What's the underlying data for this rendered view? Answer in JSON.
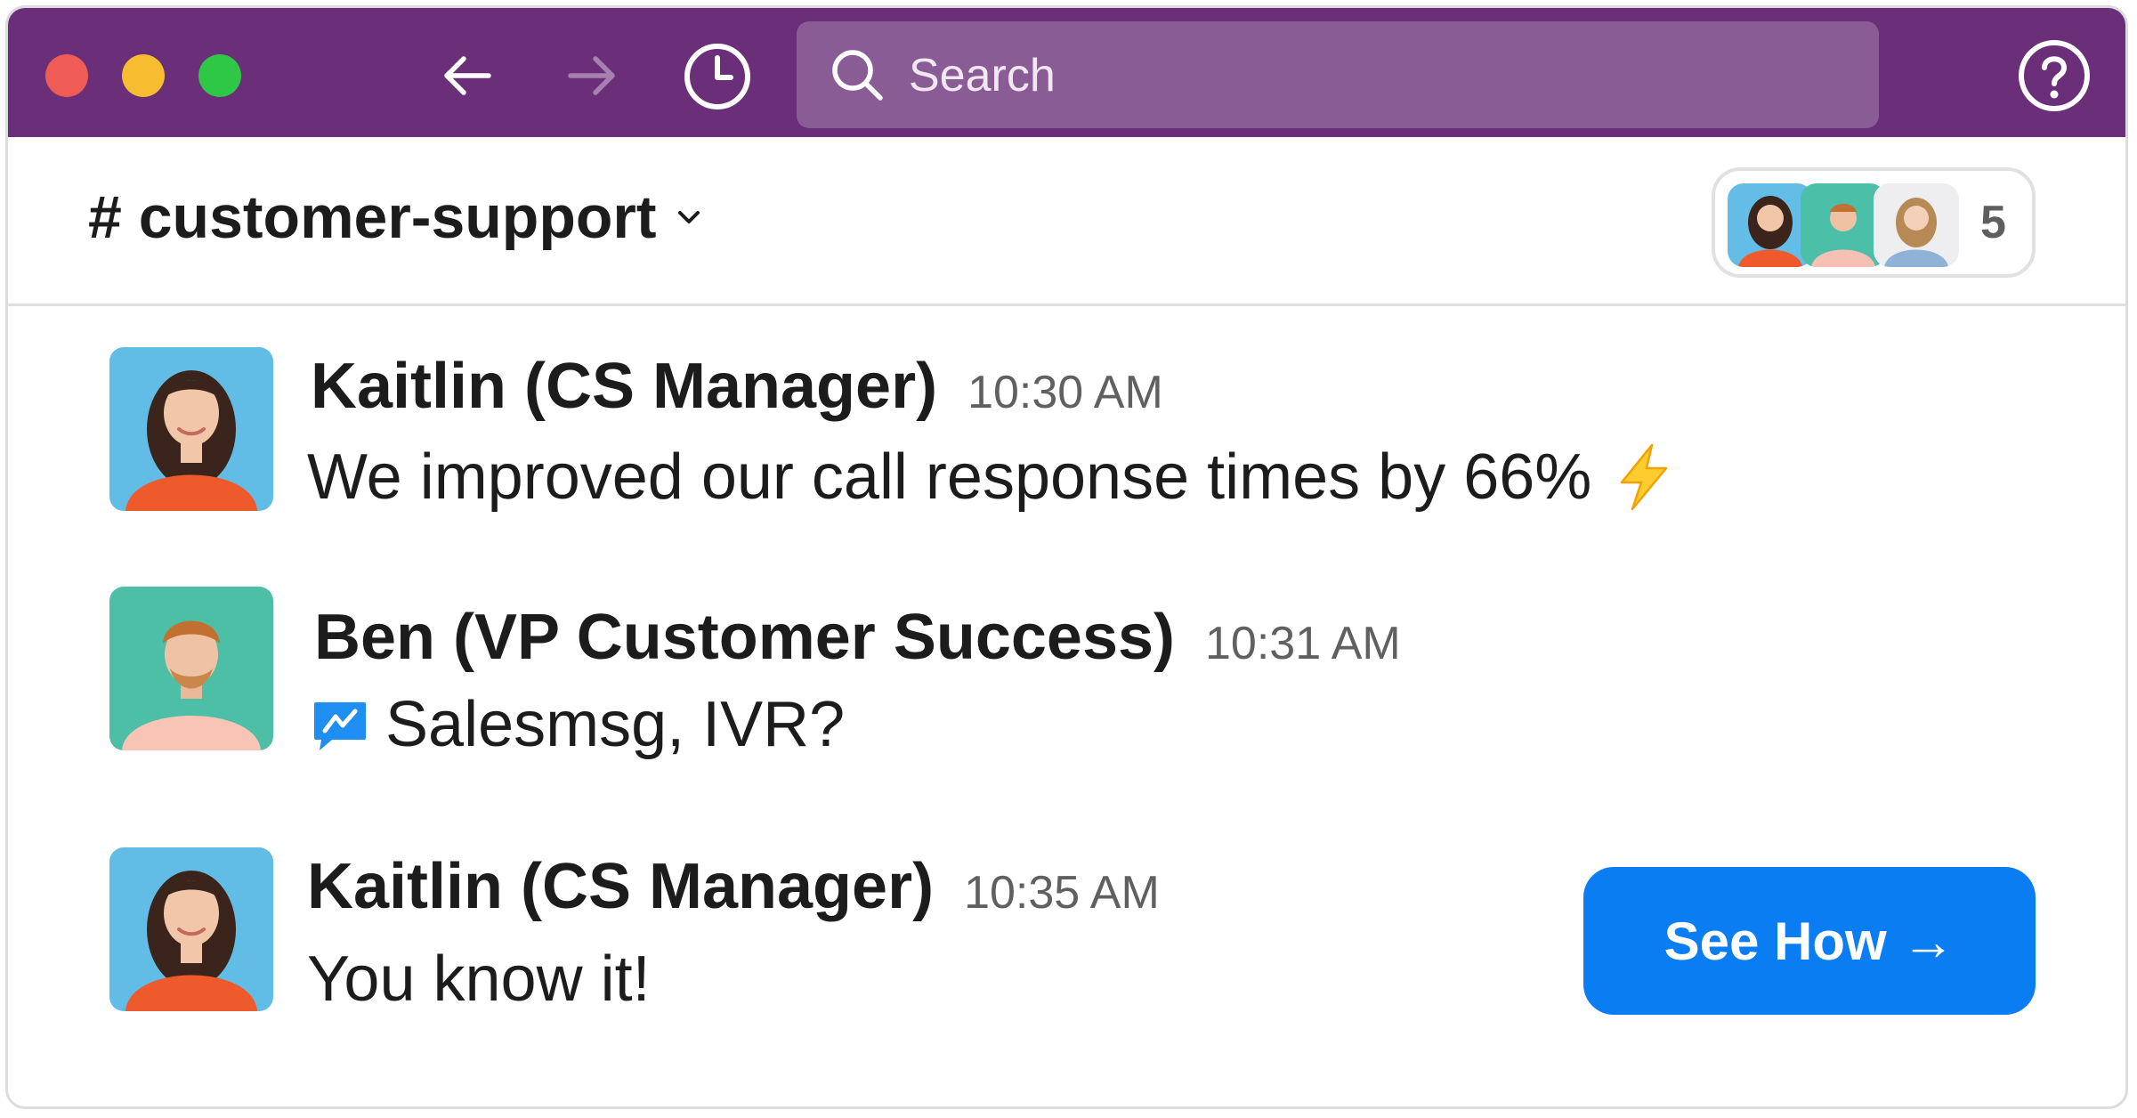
{
  "titlebar": {
    "search_placeholder": "Search"
  },
  "channel": {
    "name": "# customer-support",
    "member_count": "5"
  },
  "messages": [
    {
      "author": "Kaitlin (CS Manager)",
      "time": "10:30 AM",
      "text": "We improved our call response times by 66%",
      "emoji": "high-voltage"
    },
    {
      "author": "Ben (VP Customer Success)",
      "time": "10:31 AM",
      "text": "Salesmsg, IVR?",
      "app_icon": "salesmsg-icon"
    },
    {
      "author": "Kaitlin (CS Manager)",
      "time": "10:35 AM",
      "text": "You know it!"
    }
  ],
  "cta": {
    "label": "See How →",
    "color": "#0a7df2"
  },
  "colors": {
    "titlebar": "#6a2f78",
    "search_bg": "#8a5c95"
  }
}
